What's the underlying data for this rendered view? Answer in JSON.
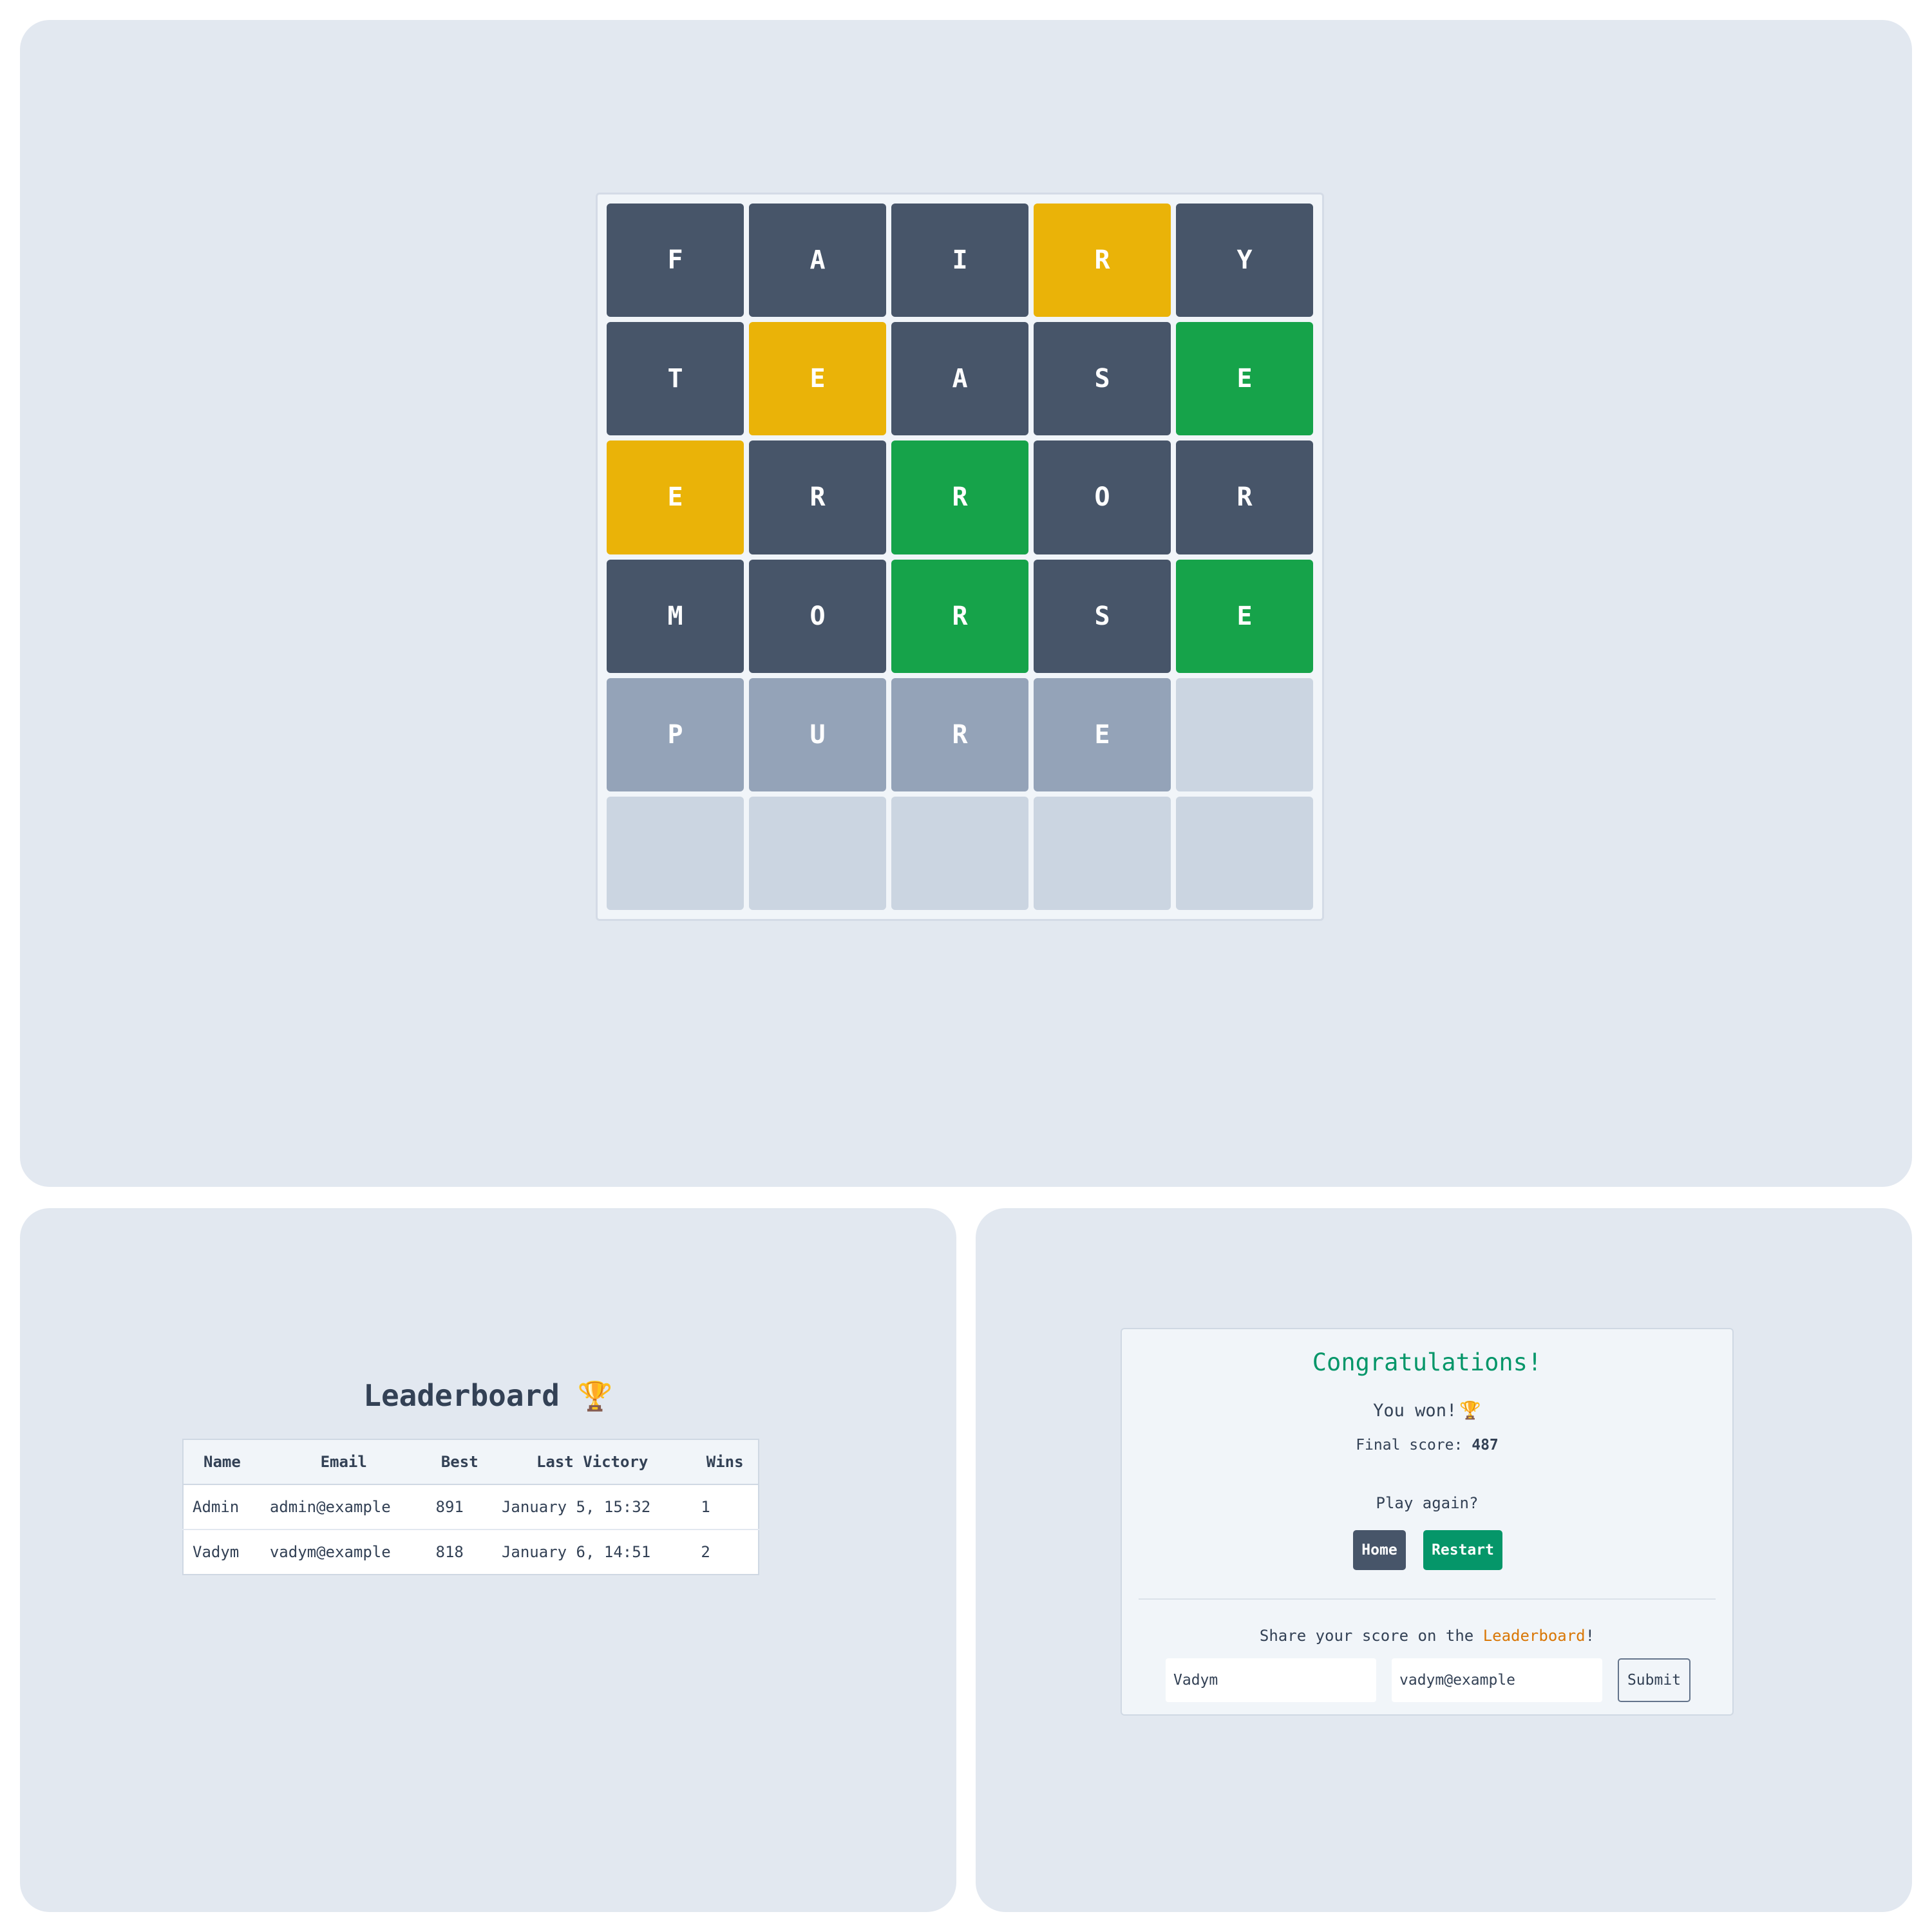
{
  "board": {
    "rows": [
      [
        {
          "letter": "F",
          "state": "absent"
        },
        {
          "letter": "A",
          "state": "absent"
        },
        {
          "letter": "I",
          "state": "absent"
        },
        {
          "letter": "R",
          "state": "present"
        },
        {
          "letter": "Y",
          "state": "absent"
        }
      ],
      [
        {
          "letter": "T",
          "state": "absent"
        },
        {
          "letter": "E",
          "state": "present"
        },
        {
          "letter": "A",
          "state": "absent"
        },
        {
          "letter": "S",
          "state": "absent"
        },
        {
          "letter": "E",
          "state": "correct"
        }
      ],
      [
        {
          "letter": "E",
          "state": "present"
        },
        {
          "letter": "R",
          "state": "absent"
        },
        {
          "letter": "R",
          "state": "correct"
        },
        {
          "letter": "O",
          "state": "absent"
        },
        {
          "letter": "R",
          "state": "absent"
        }
      ],
      [
        {
          "letter": "M",
          "state": "absent"
        },
        {
          "letter": "O",
          "state": "absent"
        },
        {
          "letter": "R",
          "state": "correct"
        },
        {
          "letter": "S",
          "state": "absent"
        },
        {
          "letter": "E",
          "state": "correct"
        }
      ],
      [
        {
          "letter": "P",
          "state": "typed"
        },
        {
          "letter": "U",
          "state": "typed"
        },
        {
          "letter": "R",
          "state": "typed"
        },
        {
          "letter": "E",
          "state": "typed"
        },
        {
          "letter": "",
          "state": "empty"
        }
      ],
      [
        {
          "letter": "",
          "state": "empty"
        },
        {
          "letter": "",
          "state": "empty"
        },
        {
          "letter": "",
          "state": "empty"
        },
        {
          "letter": "",
          "state": "empty"
        },
        {
          "letter": "",
          "state": "empty"
        }
      ]
    ],
    "colors": {
      "absent": "#475569",
      "present": "#eab308",
      "correct": "#16a34a",
      "typed": "#94a3b8",
      "empty": "#cbd5e1"
    }
  },
  "leaderboard": {
    "title": "Leaderboard",
    "title_icon": "trophy-icon",
    "trophy_glyph": "🏆",
    "columns": [
      "Name",
      "Email",
      "Best",
      "Last Victory",
      "Wins"
    ],
    "rows": [
      [
        "Admin",
        "admin@example",
        "891",
        "January 5, 15:32",
        "1"
      ],
      [
        "Vadym",
        "vadym@example",
        "818",
        "January 6, 14:51",
        "2"
      ]
    ]
  },
  "result": {
    "title": "Congratulations!",
    "you_won": "You won!",
    "trophy_glyph": "🏆",
    "final_score_label": "Final score:",
    "final_score": "487",
    "play_again": "Play again?",
    "home_label": "Home",
    "restart_label": "Restart",
    "share_prefix": "Share your score on the",
    "share_link": "Leaderboard",
    "share_suffix": "!",
    "name_value": "Vadym",
    "email_value": "vadym@example",
    "submit_label": "Submit",
    "accent_color": "#059669",
    "link_color": "#d97706"
  }
}
